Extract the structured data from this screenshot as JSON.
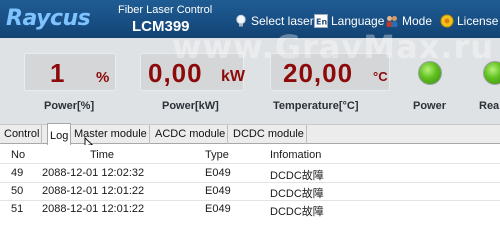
{
  "header": {
    "logo": "Raycus",
    "app_title": "Fiber Laser Control",
    "device_name": "LCM399",
    "buttons": [
      {
        "label": "Select laser",
        "icon": "bulb-icon"
      },
      {
        "label": "Language",
        "icon": "language-icon"
      },
      {
        "label": "Mode",
        "icon": "users-icon"
      },
      {
        "label": "License",
        "icon": "license-icon"
      }
    ]
  },
  "gauges": {
    "power_percent": {
      "value": "1",
      "unit": "%",
      "label": "Power[%]"
    },
    "power_kw": {
      "value": "0,00",
      "unit": "kW",
      "label": "Power[kW]"
    },
    "temperature": {
      "value": "20,00",
      "unit": "°C",
      "label": "Temperature[°C]"
    },
    "indicators": [
      {
        "label": "Power",
        "color": "#5fbf1f"
      },
      {
        "label": "Rea",
        "color": "#5fbf1f"
      }
    ]
  },
  "tabs": [
    "Control",
    "Log",
    "Master module",
    "ACDC module",
    "DCDC module"
  ],
  "active_tab": "Log",
  "log_table": {
    "columns": [
      "No",
      "Time",
      "Type",
      "Infomation"
    ],
    "rows": [
      {
        "no": "49",
        "time": "2088-12-01 12:02:32",
        "type": "E049",
        "info": "DCDC故障"
      },
      {
        "no": "50",
        "time": "2088-12-01 12:01:22",
        "type": "E049",
        "info": "DCDC故障"
      },
      {
        "no": "51",
        "time": "2088-12-01 12:01:22",
        "type": "E049",
        "info": "DCDC故障"
      }
    ]
  },
  "watermark": "www.GravMax.ru",
  "colors": {
    "header_bg": "#184f84",
    "value_red": "#8c0a0a",
    "led_green": "#5fbf1f",
    "logo_blue": "#7ec3ff"
  }
}
